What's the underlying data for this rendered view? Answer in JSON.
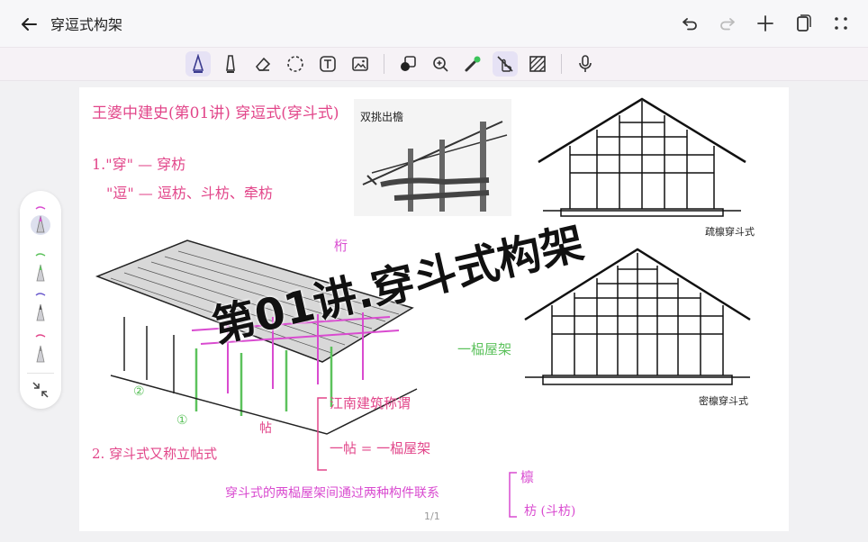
{
  "header": {
    "title": "穿逗式构架",
    "icons": [
      "back-arrow-icon",
      "undo-icon",
      "redo-icon",
      "add-icon",
      "pages-icon",
      "grid-icon"
    ]
  },
  "toolbar": {
    "tools": [
      "pen-icon",
      "highlighter-icon",
      "eraser-icon",
      "lasso-icon",
      "text-icon",
      "image-icon",
      "shape-icon",
      "zoom-icon",
      "laser-icon",
      "touch-draw-icon",
      "pattern-icon",
      "microphone-icon"
    ]
  },
  "page": {
    "number": "1/1",
    "overlay_title": "第01讲.穿斗式构架",
    "notes": {
      "heading": "王婆中建史(第01讲) 穿逗式(穿斗式)",
      "item1_a": "1.\"穿\" — 穿枋",
      "item1_b": "\"逗\" — 逗枋、斗枋、牵枋",
      "item2": "2. 穿斗式又称立帖式",
      "tie_label": "帖",
      "branch_a": "江南建筑称谓",
      "branch_b": "一帖 = 一榀屋架",
      "pin_label": "一榀屋架",
      "bottom": "穿斗式的两榀屋架间通过两种构件联系",
      "bottom_a": "檩",
      "bottom_b": "枋 (斗枋)",
      "upper_label": "桁",
      "circle1": "①",
      "circle2": "②"
    },
    "captions": {
      "double_eave": "双挑出檐",
      "sparse": "疏檩穿斗式",
      "dense": "密檩穿斗式"
    }
  }
}
